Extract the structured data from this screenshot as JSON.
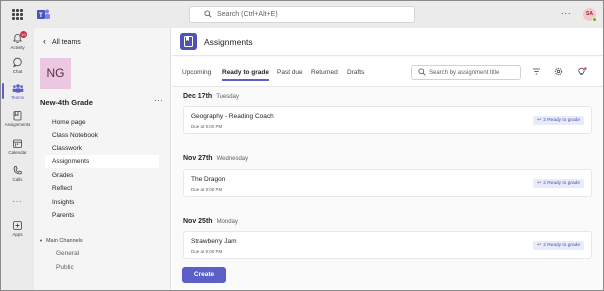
{
  "topbar": {
    "search_placeholder": "Search (Ctrl+Alt+E)",
    "more_label": "...",
    "avatar_initials": "SA"
  },
  "rail": {
    "items": [
      {
        "label": "Activity",
        "icon": "bell-icon",
        "badge": "10"
      },
      {
        "label": "Chat",
        "icon": "chat-icon"
      },
      {
        "label": "Teams",
        "icon": "teams-icon",
        "active": true
      },
      {
        "label": "Assignments",
        "icon": "assignments-icon"
      },
      {
        "label": "Calendar",
        "icon": "calendar-icon"
      },
      {
        "label": "Calls",
        "icon": "phone-icon"
      },
      {
        "label": "...",
        "icon": "more-icon"
      },
      {
        "label": "Apps",
        "icon": "apps-icon"
      }
    ]
  },
  "sidebar": {
    "back_label": "All teams",
    "team_initials": "NG",
    "team_name": "New-4th Grade",
    "more_label": "···",
    "items": [
      {
        "label": "Home page"
      },
      {
        "label": "Class Notebook"
      },
      {
        "label": "Classwork"
      },
      {
        "label": "Assignments",
        "selected": true
      },
      {
        "label": "Grades"
      },
      {
        "label": "Reflect"
      },
      {
        "label": "Insights"
      },
      {
        "label": "Parents"
      }
    ],
    "main_channels_label": "Main Channels",
    "channels": [
      {
        "label": "General"
      },
      {
        "label": "Public"
      }
    ]
  },
  "main": {
    "title": "Assignments",
    "tabs": [
      {
        "label": "Upcoming"
      },
      {
        "label": "Ready to grade",
        "active": true
      },
      {
        "label": "Past due"
      },
      {
        "label": "Returned"
      },
      {
        "label": "Drafts"
      }
    ],
    "search_placeholder": "Search by assignment title",
    "groups": [
      {
        "date": "Dec 17th",
        "weekday": "Tuesday",
        "title": "Geography - Reading Coach",
        "due": "Due at 9:00 PM",
        "status": "2 Ready to grade"
      },
      {
        "date": "Nov 27th",
        "weekday": "Wednesday",
        "title": "The Dragon",
        "due": "Due at 9:00 PM",
        "status": "2 Ready to grade"
      },
      {
        "date": "Nov 25th",
        "weekday": "Monday",
        "title": "Strawberry Jam",
        "due": "Due at 9:00 PM",
        "status": "2 Ready to grade"
      }
    ],
    "create_label": "Create"
  },
  "colors": {
    "accent": "#5b5fc7",
    "rail_bg": "#ebebeb",
    "team_tile": "#ecc8e0",
    "status_pill_bg": "#e8ebfa"
  }
}
